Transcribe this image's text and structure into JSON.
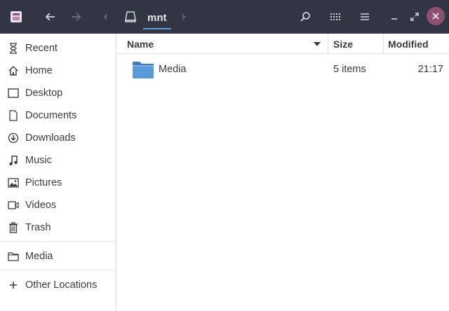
{
  "header": {
    "current_folder": "mnt",
    "close_color": "#8f4f73",
    "bar_color": "#323644",
    "icons": {
      "app": "files-app-icon",
      "back": "arrow-left-icon",
      "forward": "arrow-right-icon",
      "drive": "drive-icon",
      "search": "search-icon",
      "view": "grid-view-icon",
      "menu": "hamburger-menu-icon",
      "minimize": "minimize-icon",
      "maximize": "maximize-icon",
      "close": "close-icon"
    }
  },
  "sidebar": {
    "items": [
      {
        "label": "Recent",
        "icon": "clock-icon"
      },
      {
        "label": "Home",
        "icon": "home-icon"
      },
      {
        "label": "Desktop",
        "icon": "desktop-icon"
      },
      {
        "label": "Documents",
        "icon": "document-icon"
      },
      {
        "label": "Downloads",
        "icon": "download-icon"
      },
      {
        "label": "Music",
        "icon": "music-icon"
      },
      {
        "label": "Pictures",
        "icon": "pictures-icon"
      },
      {
        "label": "Videos",
        "icon": "video-icon"
      },
      {
        "label": "Trash",
        "icon": "trash-icon"
      },
      {
        "label": "Media",
        "icon": "folder-icon"
      },
      {
        "label": "Other Locations",
        "icon": "plus-icon"
      }
    ]
  },
  "list": {
    "columns": {
      "name": "Name",
      "size": "Size",
      "modified": "Modified"
    },
    "rows": [
      {
        "name": "Media",
        "size": "5 items",
        "modified": "21:17",
        "icon": "folder-icon"
      }
    ],
    "folder_color": "#4f8ed1"
  }
}
